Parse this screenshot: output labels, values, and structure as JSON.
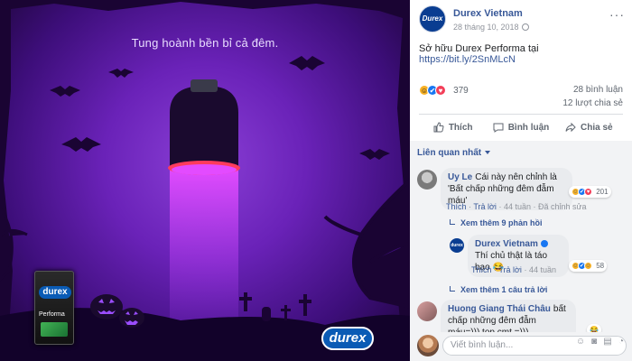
{
  "image": {
    "tagline": "Tung hoành bền bỉ cả đêm.",
    "box_logo": "durex",
    "box_name": "Performa",
    "brand_logo": "durex",
    "colors": {
      "bg_center": "#8a3fd6",
      "bg_edge": "#1a0433",
      "glow": "#e34bff",
      "pumpkin": "#1a0a2e"
    }
  },
  "post": {
    "page_avatar": "Durex",
    "page_name": "Durex Vietnam",
    "date": "28 tháng 10, 2018",
    "more": "···",
    "text_prefix": "Sở hữu Durex Performa tại ",
    "text_link": "https://bit.ly/2SnMLcN",
    "reactions": {
      "icons": [
        "haha-icon",
        "like-icon",
        "love-icon"
      ],
      "count": "379"
    },
    "comments_count": "28 bình luận",
    "shares_count": "12 lượt chia sẻ",
    "actions": {
      "like": "Thích",
      "comment": "Bình luận",
      "share": "Chia sẻ"
    }
  },
  "comments": {
    "sort_label": "Liên quan nhất",
    "items": [
      {
        "author": "Uy Le",
        "text": "Cái này nên chỉnh là 'Bất chấp những đêm đẫm máu'",
        "reactions": "201",
        "like": "Thích",
        "reply": "Trả lời",
        "time": "44 tuần",
        "edited": "Đã chỉnh sửa",
        "view_more": "Xem thêm 9 phản hồi"
      },
      {
        "author": "Durex Vietnam",
        "text": "Thí chủ thật là táo bạo 😂",
        "reactions": "58",
        "like": "Thích",
        "reply": "Trả lời",
        "time": "44 tuần",
        "view_more": "Xem thêm 1 câu trả lời"
      },
      {
        "author": "Huong Giang Thái Châu",
        "text": "bất chấp những đêm đẫm máu=))) top cmt =)))",
        "reactions": "😂"
      }
    ],
    "composer_placeholder": "Viết bình luận..."
  }
}
